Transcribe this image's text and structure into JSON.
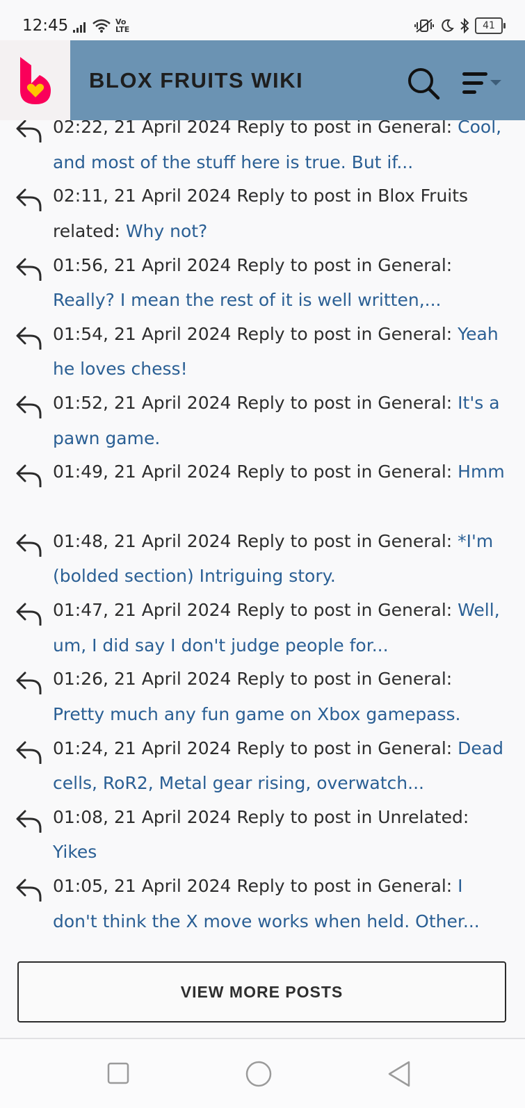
{
  "status_bar": {
    "time": "12:45",
    "network_label": "Vo LTE",
    "battery": "41",
    "icons": [
      "signal-icon",
      "wifi-icon",
      "volte-icon",
      "vibrate-icon",
      "moon-icon",
      "bluetooth-icon",
      "battery-icon"
    ]
  },
  "header": {
    "title": "BLOX FRUITS WIKI",
    "logo_icon": "fandom-logo-icon",
    "search_icon": "search-icon",
    "menu_icon": "menu-icon",
    "bg_color": "#6b93b3"
  },
  "posts": [
    {
      "meta": "02:22, 21 April 2024 Reply to post in General:",
      "link": "Cool, and most of the stuff here is true. But if..."
    },
    {
      "meta": "02:11, 21 April 2024 Reply to post in Blox Fruits related:",
      "link": "Why not?"
    },
    {
      "meta": "01:56, 21 April 2024 Reply to post in General:",
      "link": "Really? I mean the rest of it is well written,..."
    },
    {
      "meta": "01:54, 21 April 2024 Reply to post in General:",
      "link": "Yeah he loves chess!"
    },
    {
      "meta": "01:52, 21 April 2024 Reply to post in General:",
      "link": "It's a pawn game."
    },
    {
      "meta": "01:49, 21 April 2024 Reply to post in General:",
      "link": "Hmm"
    },
    {
      "meta": "01:48, 21 April 2024 Reply to post in General:",
      "link": "*I'm (bolded section) Intriguing story."
    },
    {
      "meta": "01:47, 21 April 2024 Reply to post in General:",
      "link": "Well, um, I did say I don't judge people for..."
    },
    {
      "meta": "01:26, 21 April 2024 Reply to post in General:",
      "link": "Pretty much any fun game on Xbox gamepass."
    },
    {
      "meta": "01:24, 21 April 2024 Reply to post in General:",
      "link": "Dead cells, RoR2, Metal gear rising, overwatch..."
    },
    {
      "meta": "01:08, 21 April 2024 Reply to post in Unrelated:",
      "link": "Yikes"
    },
    {
      "meta": "01:05, 21 April 2024 Reply to post in General:",
      "link": "I don't think the X move works when held. Other..."
    }
  ],
  "view_more_label": "VIEW MORE POSTS",
  "nav": {
    "icons": [
      "recents-square-icon",
      "home-circle-icon",
      "back-triangle-icon"
    ]
  },
  "colors": {
    "link": "#2a5f94",
    "logo": "#fa005a",
    "logo_heart": "#ffc500"
  }
}
